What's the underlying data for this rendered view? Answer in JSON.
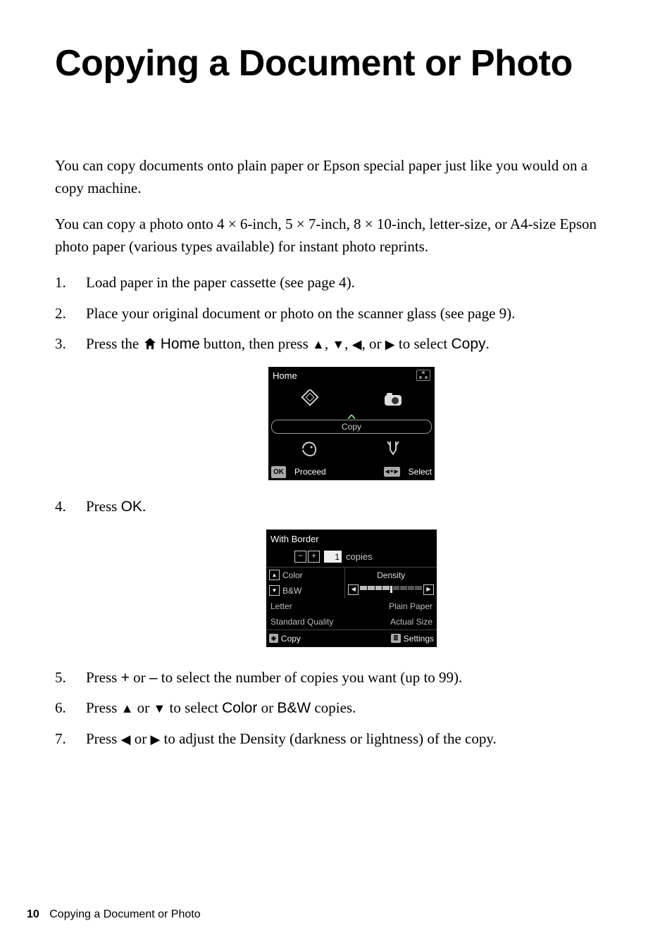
{
  "title": "Copying a Document or Photo",
  "intro1": "You can copy documents onto plain paper or Epson special paper just like you would on a copy machine.",
  "intro2": "You can copy a photo onto 4 × 6-inch, 5 × 7-inch, 8 × 10-inch, letter-size, or A4-size Epson photo paper (various types available) for instant photo reprints.",
  "steps": {
    "s1": "Load paper in the paper cassette (see page 4).",
    "s2": "Place your original document or photo on the scanner glass (see page 9).",
    "s3_a": "Press the ",
    "s3_home": " Home",
    "s3_b": " button, then press ",
    "s3_c": ", or ",
    "s3_d": " to select ",
    "s3_copy": "Copy",
    "s3_e": ".",
    "s4_a": "Press ",
    "s4_ok": "OK",
    "s4_b": ".",
    "s5_a": "Press ",
    "s5_plus": "+",
    "s5_or": " or ",
    "s5_minus": "–",
    "s5_b": " to select the number of copies you want (up to 99).",
    "s6_a": "Press ",
    "s6_or": " or ",
    "s6_b": " to select ",
    "s6_color": "Color",
    "s6_or2": " or ",
    "s6_bw": "B&W",
    "s6_c": " copies.",
    "s7_a": "Press ",
    "s7_or": " or ",
    "s7_b": " to adjust the Density (darkness or lightness) of the copy."
  },
  "lcd_home": {
    "title": "Home",
    "copy": "Copy",
    "ok": "OK",
    "proceed": "Proceed",
    "select": "Select"
  },
  "lcd_copy": {
    "title": "With Border",
    "count": "1",
    "copies": "copies",
    "color": "Color",
    "bw": "B&W",
    "density": "Density",
    "letter": "Letter",
    "plain": "Plain Paper",
    "std": "Standard Quality",
    "actual": "Actual Size",
    "copybtn": "Copy",
    "settings": "Settings"
  },
  "footer": {
    "page": "10",
    "label": "Copying a Document or Photo"
  }
}
